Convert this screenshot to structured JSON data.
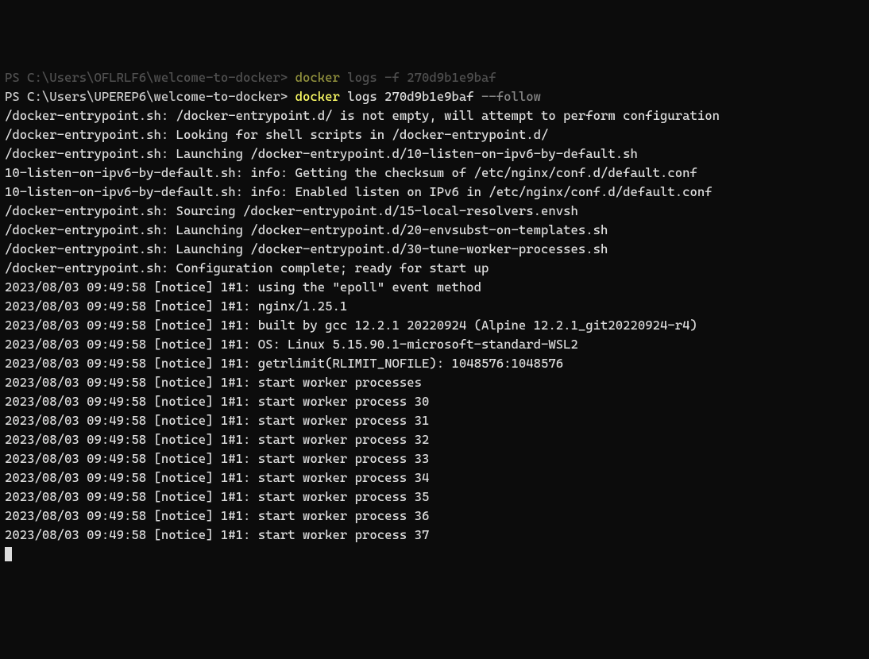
{
  "line0": {
    "prefix": "PS ",
    "path": "C:\\Users\\OFLRLF6\\welcome-to-docker> ",
    "cmd1": "docker",
    "mid": " ",
    "args1": "logs -f 270d9b1e9baf"
  },
  "line1": {
    "prefix": "PS ",
    "path": "C:\\Users\\UPEREP6\\welcome-to-docker> ",
    "cmd1": "docker",
    "mid": " ",
    "args1": "logs 270d9b1e9baf ",
    "flag": "--follow"
  },
  "logs": [
    "/docker-entrypoint.sh: /docker-entrypoint.d/ is not empty, will attempt to perform configuration",
    "/docker-entrypoint.sh: Looking for shell scripts in /docker-entrypoint.d/",
    "/docker-entrypoint.sh: Launching /docker-entrypoint.d/10-listen-on-ipv6-by-default.sh",
    "10-listen-on-ipv6-by-default.sh: info: Getting the checksum of /etc/nginx/conf.d/default.conf",
    "10-listen-on-ipv6-by-default.sh: info: Enabled listen on IPv6 in /etc/nginx/conf.d/default.conf",
    "/docker-entrypoint.sh: Sourcing /docker-entrypoint.d/15-local-resolvers.envsh",
    "/docker-entrypoint.sh: Launching /docker-entrypoint.d/20-envsubst-on-templates.sh",
    "/docker-entrypoint.sh: Launching /docker-entrypoint.d/30-tune-worker-processes.sh",
    "/docker-entrypoint.sh: Configuration complete; ready for start up",
    "2023/08/03 09:49:58 [notice] 1#1: using the \"epoll\" event method",
    "2023/08/03 09:49:58 [notice] 1#1: nginx/1.25.1",
    "2023/08/03 09:49:58 [notice] 1#1: built by gcc 12.2.1 20220924 (Alpine 12.2.1_git20220924-r4)",
    "2023/08/03 09:49:58 [notice] 1#1: OS: Linux 5.15.90.1-microsoft-standard-WSL2",
    "2023/08/03 09:49:58 [notice] 1#1: getrlimit(RLIMIT_NOFILE): 1048576:1048576",
    "2023/08/03 09:49:58 [notice] 1#1: start worker processes",
    "2023/08/03 09:49:58 [notice] 1#1: start worker process 30",
    "2023/08/03 09:49:58 [notice] 1#1: start worker process 31",
    "2023/08/03 09:49:58 [notice] 1#1: start worker process 32",
    "2023/08/03 09:49:58 [notice] 1#1: start worker process 33",
    "2023/08/03 09:49:58 [notice] 1#1: start worker process 34",
    "2023/08/03 09:49:58 [notice] 1#1: start worker process 35",
    "2023/08/03 09:49:58 [notice] 1#1: start worker process 36",
    "2023/08/03 09:49:58 [notice] 1#1: start worker process 37"
  ]
}
